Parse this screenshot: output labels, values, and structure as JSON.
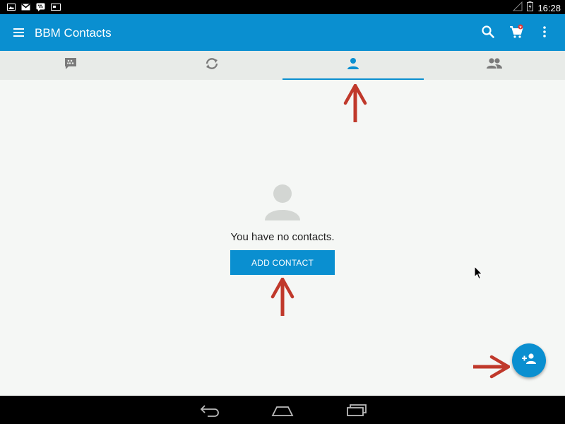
{
  "status_bar": {
    "time": "16:28",
    "notification_icons": [
      "image-notification-icon",
      "gmail-icon",
      "bbm-notification-icon",
      "tablet-icon"
    ],
    "system_icons": [
      "no-signal-icon",
      "battery-charging-icon"
    ]
  },
  "app_bar": {
    "title": "BBM Contacts",
    "icons": [
      "menu-icon",
      "search-icon",
      "shop-cart-icon",
      "overflow-menu-icon"
    ]
  },
  "tabs": [
    {
      "icon": "chat-icon",
      "active": false
    },
    {
      "icon": "updates-icon",
      "active": false
    },
    {
      "icon": "contact-person-icon",
      "active": true
    },
    {
      "icon": "groups-icon",
      "active": false
    }
  ],
  "empty_state": {
    "message": "You have no contacts.",
    "button_label": "ADD CONTACT"
  },
  "fab": {
    "icon": "add-person-icon"
  },
  "annotations": {
    "arrow_color": "#c0392b"
  },
  "colors": {
    "primary": "#0a8fd0",
    "tab_bg": "#e8ebe8",
    "content_bg": "#f5f7f5",
    "icon_grey": "#7a7a7a"
  },
  "nav_bar": {
    "icons": [
      "back-icon",
      "home-icon",
      "recents-icon"
    ]
  }
}
